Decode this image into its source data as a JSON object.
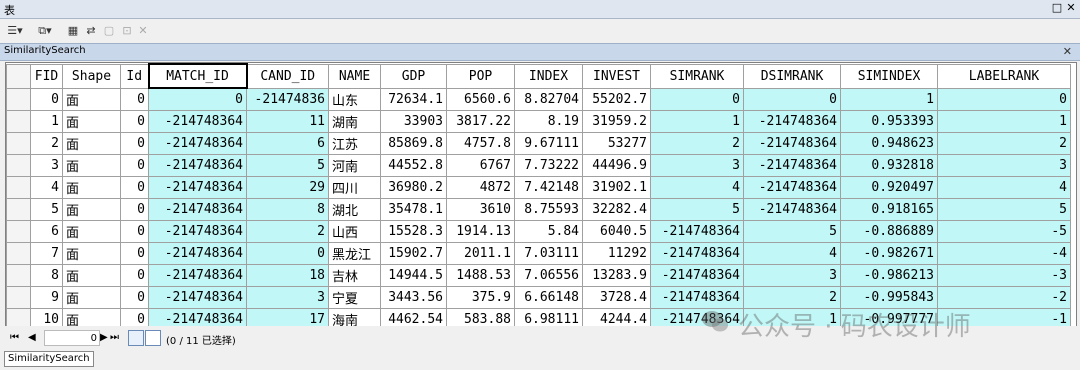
{
  "window": {
    "title": "表"
  },
  "tab": {
    "label": "SimilaritySearch"
  },
  "columns": [
    "FID",
    "Shape",
    "Id",
    "MATCH_ID",
    "CAND_ID",
    "NAME",
    "GDP",
    "POP",
    "INDEX",
    "INVEST",
    "SIMRANK",
    "DSIMRANK",
    "SIMINDEX",
    "LABELRANK"
  ],
  "rows": [
    [
      "0",
      "面",
      "0",
      "0",
      "-21474836",
      "山东",
      "72634.1",
      "6560.6",
      "8.82704",
      "55202.7",
      "0",
      "0",
      "1",
      "0"
    ],
    [
      "1",
      "面",
      "0",
      "-214748364",
      "11",
      "湖南",
      "33903",
      "3817.22",
      "8.19",
      "31959.2",
      "1",
      "-214748364",
      "0.953393",
      "1"
    ],
    [
      "2",
      "面",
      "0",
      "-214748364",
      "6",
      "江苏",
      "85869.8",
      "4757.8",
      "9.67111",
      "53277",
      "2",
      "-214748364",
      "0.948623",
      "2"
    ],
    [
      "3",
      "面",
      "0",
      "-214748364",
      "5",
      "河南",
      "44552.8",
      "6767",
      "7.73222",
      "44496.9",
      "3",
      "-214748364",
      "0.932818",
      "3"
    ],
    [
      "4",
      "面",
      "0",
      "-214748364",
      "29",
      "四川",
      "36980.2",
      "4872",
      "7.42148",
      "31902.1",
      "4",
      "-214748364",
      "0.920497",
      "4"
    ],
    [
      "5",
      "面",
      "0",
      "-214748364",
      "8",
      "湖北",
      "35478.1",
      "3610",
      "8.75593",
      "32282.4",
      "5",
      "-214748364",
      "0.918165",
      "5"
    ],
    [
      "6",
      "面",
      "0",
      "-214748364",
      "2",
      "山西",
      "15528.3",
      "1914.13",
      "5.84",
      "6040.5",
      "-214748364",
      "5",
      "-0.886889",
      "-5"
    ],
    [
      "7",
      "面",
      "0",
      "-214748364",
      "0",
      "黑龙江",
      "15902.7",
      "2011.1",
      "7.03111",
      "11292",
      "-214748364",
      "4",
      "-0.982671",
      "-4"
    ],
    [
      "8",
      "面",
      "0",
      "-214748364",
      "18",
      "吉林",
      "14944.5",
      "1488.53",
      "7.06556",
      "13283.9",
      "-214748364",
      "3",
      "-0.986213",
      "-3"
    ],
    [
      "9",
      "面",
      "0",
      "-214748364",
      "3",
      "宁夏",
      "3443.56",
      "375.9",
      "6.66148",
      "3728.4",
      "-214748364",
      "2",
      "-0.995843",
      "-2"
    ],
    [
      "10",
      "面",
      "0",
      "-214748364",
      "17",
      "海南",
      "4462.54",
      "583.88",
      "6.98111",
      "4244.4",
      "-214748364",
      "1",
      "-0.997777",
      "-1"
    ]
  ],
  "status": {
    "record_value": "0",
    "selection": "(0 / 11 已选择)"
  },
  "bottom_tab": "SimilaritySearch",
  "watermark": "公众号 · 码农设计师",
  "colors": {
    "selected_fill": "#c2f7f7"
  }
}
